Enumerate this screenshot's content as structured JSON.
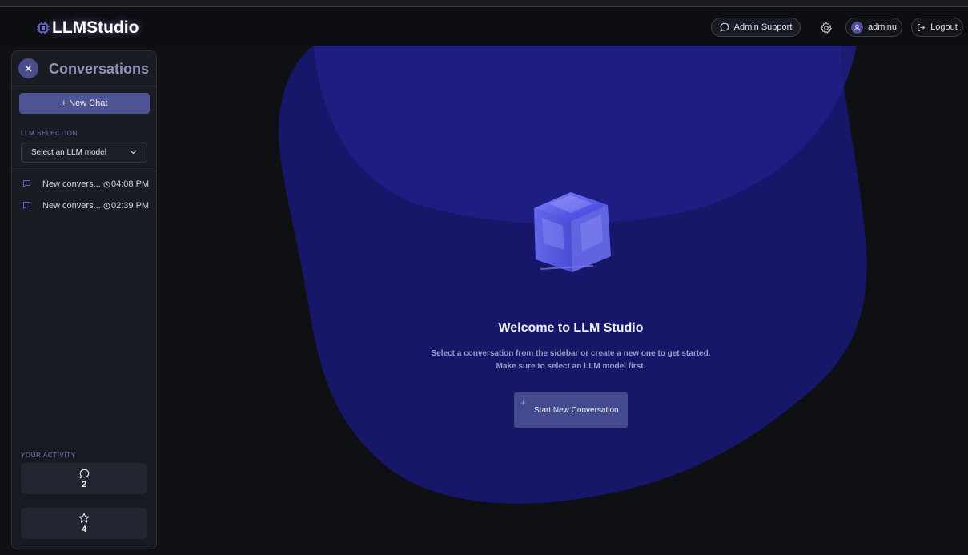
{
  "header": {
    "logo_text": "LLMStudio",
    "support_label": "Admin Support",
    "username": "adminu",
    "logout_label": "Logout"
  },
  "sidebar": {
    "title": "Conversations",
    "new_chat_label": "+ New Chat",
    "llm_section_label": "LLM SELECTION",
    "llm_select_placeholder": "Select an LLM model",
    "conversations": [
      {
        "title": "New convers...",
        "time": "04:08 PM"
      },
      {
        "title": "New convers...",
        "time": "02:39 PM"
      }
    ],
    "activity_label": "YOUR ACTIVITY",
    "activity_stats": [
      {
        "icon": "message-icon",
        "value": "2"
      },
      {
        "icon": "star-icon",
        "value": "4"
      }
    ]
  },
  "main": {
    "welcome_title": "Welcome to LLM Studio",
    "welcome_subtitle": "Select a conversation from the sidebar or create a new one to get started. Make sure to select an LLM model first.",
    "start_button_label": "Start New Conversation"
  },
  "colors": {
    "background": "#0f1014",
    "sidebar": "#1a1c24",
    "accent": "#4e5394",
    "blob": "#1b1b6e"
  }
}
